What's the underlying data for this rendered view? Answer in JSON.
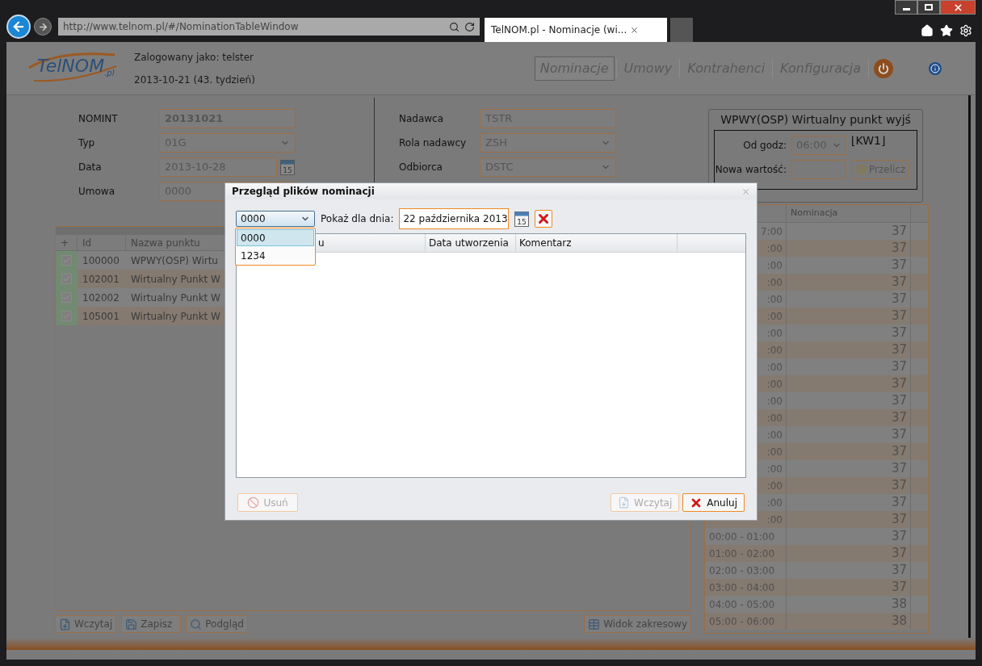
{
  "browser": {
    "url": "http://www.telnom.pl/#/NominationTableWindow",
    "tab_title": "TelNOM.pl - Nominacje (wi..."
  },
  "header": {
    "logo_text": "TelNOM",
    "logo_suffix": ".pl",
    "user_line": "Zalogowany jako: telster",
    "date_line": "2013-10-21 (43. tydzień)",
    "nav": [
      {
        "label": "Nominacje",
        "selected": true
      },
      {
        "label": "Umowy",
        "selected": false
      },
      {
        "label": "Kontrahenci",
        "selected": false
      },
      {
        "label": "Konfiguracja",
        "selected": false
      }
    ]
  },
  "form_left": [
    {
      "label": "NOMINT",
      "value": "20131021",
      "kind": "text"
    },
    {
      "label": "Typ",
      "value": "01G",
      "kind": "select"
    },
    {
      "label": "Data",
      "value": "2013-10-28",
      "kind": "date",
      "calendar_day": "15"
    },
    {
      "label": "Umowa",
      "value": "0000",
      "kind": "text"
    }
  ],
  "form_right": [
    {
      "label": "Nadawca",
      "value": "TSTR",
      "kind": "text"
    },
    {
      "label": "Rola nadawcy",
      "value": "ZSH",
      "kind": "select"
    },
    {
      "label": "Odbiorca",
      "value": "DSTC",
      "kind": "select"
    }
  ],
  "points_table": {
    "columns": [
      "+",
      "Id",
      "Nazwa punktu"
    ],
    "rows": [
      {
        "checked": true,
        "id": "100000",
        "name": "WPWY(OSP) Wirtu"
      },
      {
        "checked": true,
        "id": "102001",
        "name": "Wirtualny Punkt W"
      },
      {
        "checked": true,
        "id": "102002",
        "name": "Wirtualny Punkt W"
      },
      {
        "checked": true,
        "id": "105001",
        "name": "Wirtualny Punkt W"
      }
    ]
  },
  "bottom_buttons": [
    "Wczytaj",
    "Zapisz",
    "Podgląd"
  ],
  "range_button": "Widok zakresowy",
  "right_panel": {
    "title": "WPWY(OSP) Wirtualny punkt wyjś",
    "from_label": "Od godz:",
    "from_value": "06:00",
    "tag": "⌊KW1⌋",
    "new_value_label": "Nowa wartość:",
    "recalc_button": "Przelicz"
  },
  "hours_table": {
    "columns": [
      "Nominacja"
    ],
    "rows": [
      {
        "hour": "7:00",
        "value": "37"
      },
      {
        "hour": ":00",
        "value": "37"
      },
      {
        "hour": ":00",
        "value": "37"
      },
      {
        "hour": ":00",
        "value": "37"
      },
      {
        "hour": ":00",
        "value": "37"
      },
      {
        "hour": ":00",
        "value": "37"
      },
      {
        "hour": ":00",
        "value": "37"
      },
      {
        "hour": ":00",
        "value": "37"
      },
      {
        "hour": ":00",
        "value": "37"
      },
      {
        "hour": ":00",
        "value": "37"
      },
      {
        "hour": ":00",
        "value": "37"
      },
      {
        "hour": ":00",
        "value": "37"
      },
      {
        "hour": ":00",
        "value": "37"
      },
      {
        "hour": ":00",
        "value": "37"
      },
      {
        "hour": ":00",
        "value": "37"
      },
      {
        "hour": ":00",
        "value": "37"
      },
      {
        "hour": ":00",
        "value": "37"
      },
      {
        "hour": ":00",
        "value": "37"
      },
      {
        "hour": "00:00 - 01:00",
        "value": "37"
      },
      {
        "hour": "01:00 - 02:00",
        "value": "37"
      },
      {
        "hour": "02:00 - 03:00",
        "value": "37"
      },
      {
        "hour": "03:00 - 04:00",
        "value": "37"
      },
      {
        "hour": "04:00 - 05:00",
        "value": "38"
      },
      {
        "hour": "05:00 - 06:00",
        "value": "38"
      }
    ]
  },
  "dialog": {
    "title": "Przegląd plików nominacji",
    "select_value": "0000",
    "options": [
      {
        "label": "0000",
        "selected": true
      },
      {
        "label": "1234",
        "selected": false
      }
    ],
    "date_label": "Pokaż dla dnia:",
    "date_value": "22 października 2013",
    "calendar_day": "15",
    "columns": [
      "u",
      "Data utworzenia",
      "Komentarz"
    ],
    "buttons": [
      {
        "label": "Usuń",
        "kind": "delete",
        "disabled": true
      },
      {
        "label": "Wczytaj",
        "kind": "load",
        "disabled": true
      },
      {
        "label": "Anuluj",
        "kind": "cancel",
        "disabled": false
      }
    ]
  }
}
